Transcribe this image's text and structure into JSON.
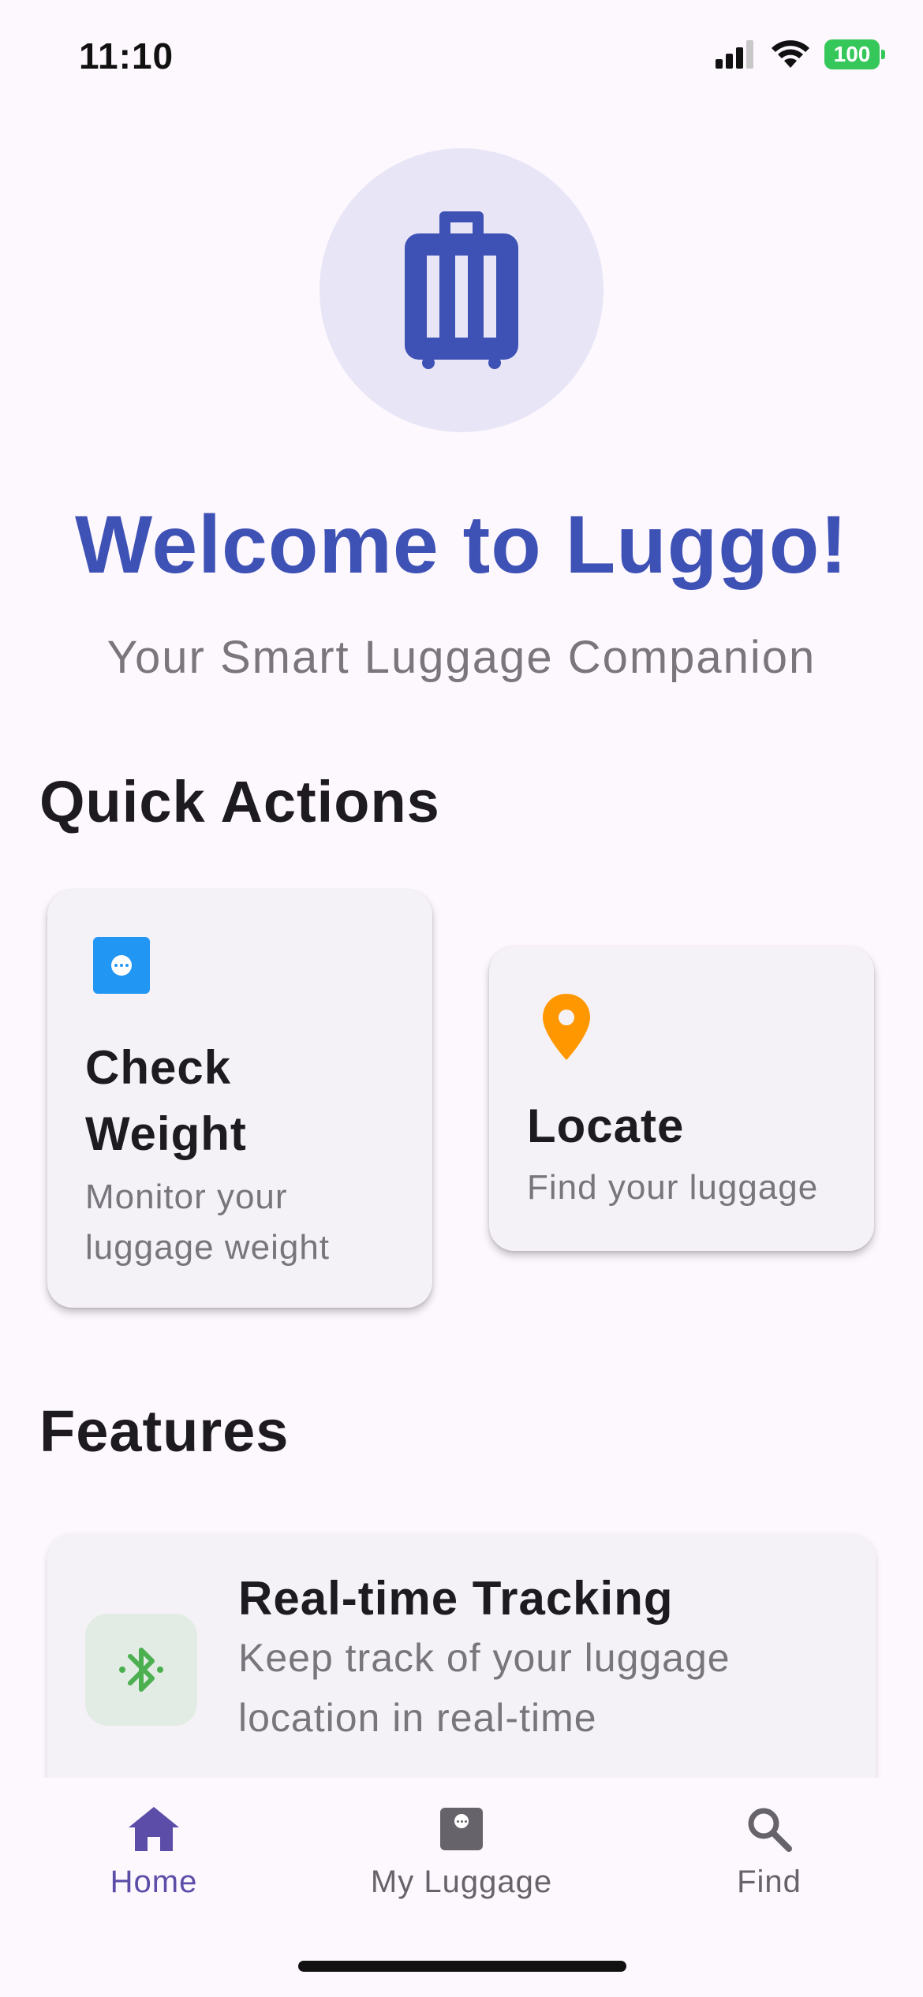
{
  "status_bar": {
    "time": "11:10",
    "battery": "100"
  },
  "hero": {
    "icon": "luggage-icon",
    "title": "Welcome to Luggo!",
    "subtitle": "Your Smart Luggage Companion"
  },
  "quick_actions": {
    "title": "Quick Actions",
    "items": [
      {
        "title": "Check Weight",
        "description": "Monitor your luggage weight",
        "icon": "scale-icon",
        "icon_color": "#2196f3"
      },
      {
        "title": "Locate",
        "description": "Find your luggage",
        "icon": "location-pin-icon",
        "icon_color": "#ff9800"
      }
    ]
  },
  "features": {
    "title": "Features",
    "items": [
      {
        "title": "Real-time Tracking",
        "description": "Keep track of your luggage location in real-time",
        "icon": "bluetooth-icon",
        "icon_color": "#4caf50"
      }
    ]
  },
  "bottom_nav": {
    "items": [
      {
        "label": "Home",
        "icon": "home-icon",
        "active": true
      },
      {
        "label": "My Luggage",
        "icon": "luggage-tag-icon",
        "active": false
      },
      {
        "label": "Find",
        "icon": "search-icon",
        "active": false
      }
    ],
    "active_color": "#5c4ea8",
    "inactive_color": "#67636b"
  },
  "colors": {
    "brand": "#3e51b5",
    "background": "#fdf7fe"
  }
}
